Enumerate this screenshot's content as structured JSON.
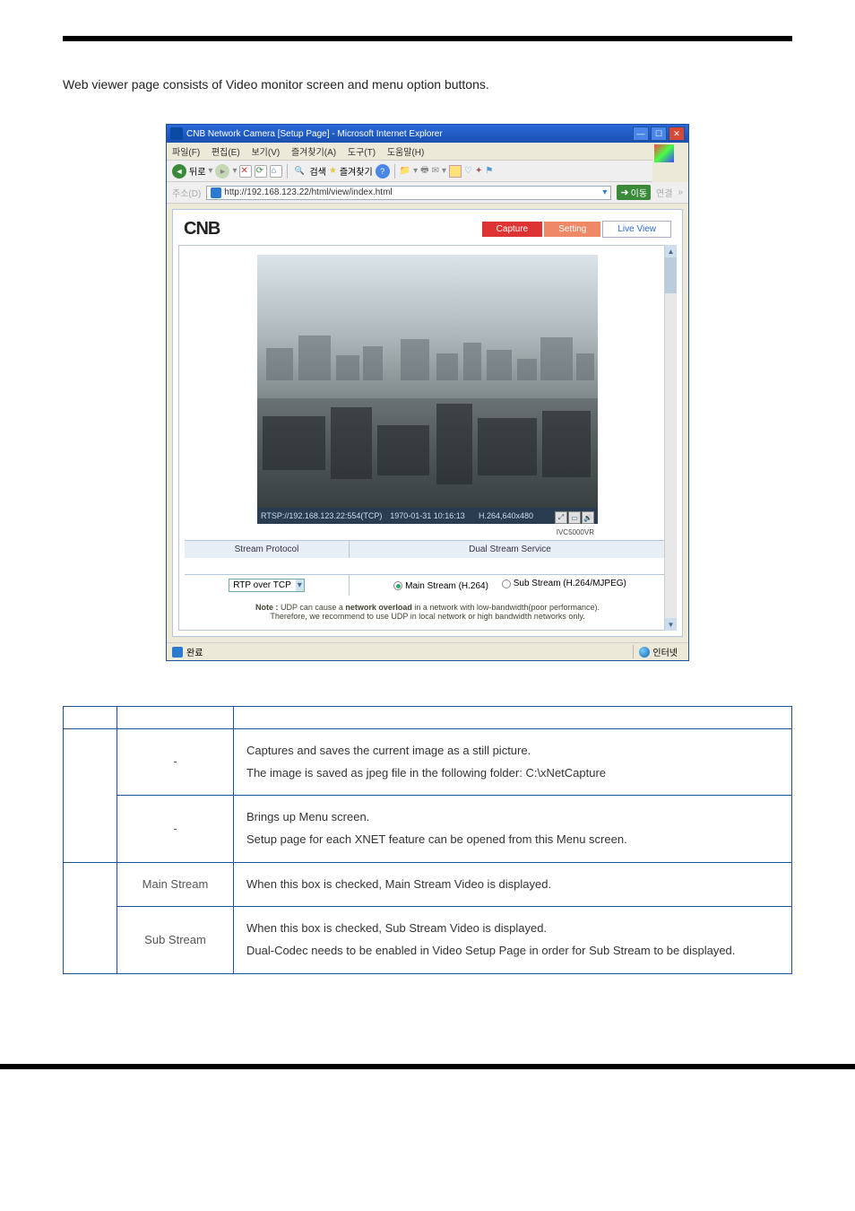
{
  "intro": "Web viewer page consists of Video monitor screen and menu option buttons.",
  "browser": {
    "title": "CNB Network Camera [Setup Page] - Microsoft Internet Explorer",
    "menus": [
      "파일(F)",
      "편집(E)",
      "보기(V)",
      "즐겨찾기(A)",
      "도구(T)",
      "도움말(H)"
    ],
    "back_label": "뒤로",
    "search_label": "검색",
    "fav_label": "즐겨찾기",
    "addr_prefix": "주소(D)",
    "url": "http://192.168.123.22/html/view/index.html",
    "go_label": "이동",
    "links_label": "연결",
    "links_chevron": "»",
    "status_done": "완료",
    "status_zone": "인터넷"
  },
  "cnb": {
    "logo": "CNB",
    "btn_capture": "Capture",
    "btn_setting": "Setting",
    "btn_live": "Live View"
  },
  "overlay": {
    "left": "RTSP://192.168.123.22:554(TCP)",
    "mid": "1970-01-31 10:16:13",
    "right": "H.264,640x480",
    "model": "IVC5000VR"
  },
  "opts": {
    "hdr_proto": "Stream Protocol",
    "hdr_dual": "Dual Stream Service",
    "proto_value": "RTP over TCP",
    "main_label": "Main Stream (H.264)",
    "sub_label": "Sub Stream (H.264/MJPEG)"
  },
  "note": {
    "lead": "Note :",
    "bold": "network overload",
    "p1": " UDP can cause a ",
    "p2": " in a network with low-bandwidth(poor performance).",
    "p3": "Therefore, we recommend to use UDP in local network or high bandwidth networks only."
  },
  "table": {
    "r1_sub": "-",
    "r1_desc_a": "Captures and saves the current image as a still picture.",
    "r1_desc_b": "The image is saved as jpeg file in the following folder: C:\\xNetCapture",
    "r2_sub": "-",
    "r2_desc_a": "Brings up Menu screen.",
    "r2_desc_b": "Setup page for each XNET feature can be opened from this Menu screen.",
    "r3_sub": "Main Stream",
    "r3_desc": "When this box is checked, Main Stream Video is displayed.",
    "r4_sub": "Sub Stream",
    "r4_desc_a": "When this box is checked, Sub Stream Video is displayed.",
    "r4_desc_b": "Dual-Codec needs to be enabled in Video Setup Page in order for Sub Stream to be displayed."
  }
}
